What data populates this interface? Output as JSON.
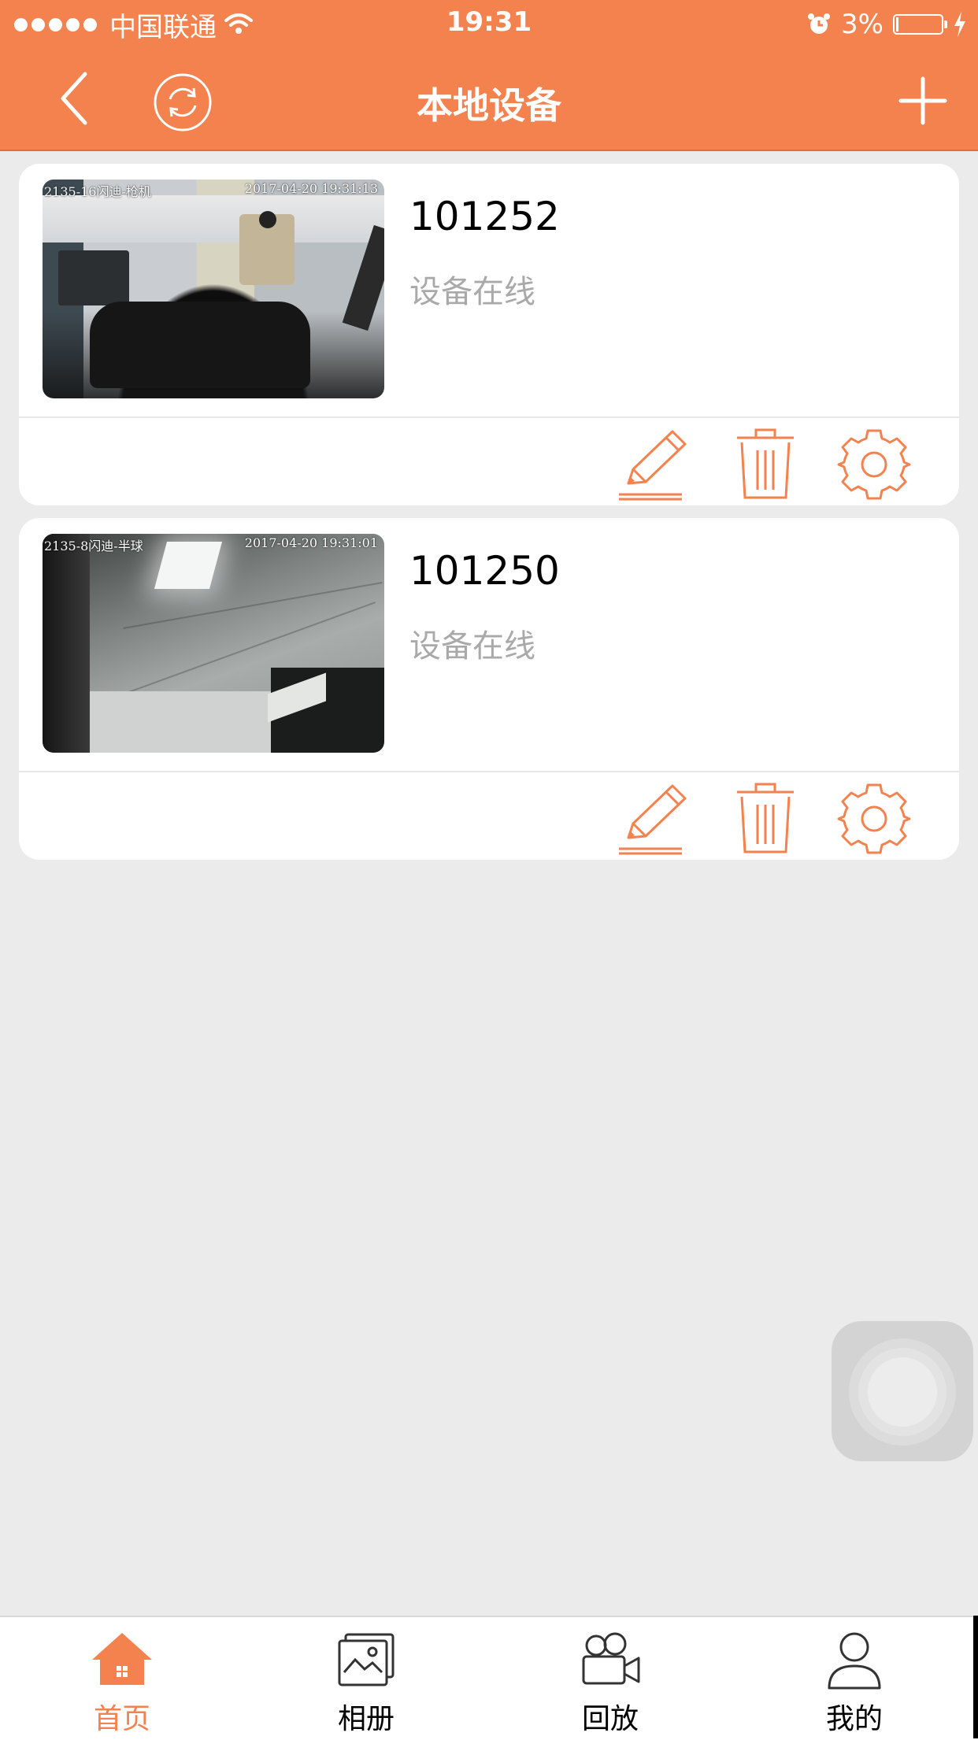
{
  "status_bar": {
    "carrier": "中国联通",
    "time": "19:31",
    "battery": "3%"
  },
  "nav": {
    "title": "本地设备"
  },
  "devices": [
    {
      "id": "101252",
      "status": "设备在线",
      "overlay_left": "2135-16闪迪-枪机",
      "overlay_right": "2017-04-20 19:31:13"
    },
    {
      "id": "101250",
      "status": "设备在线",
      "overlay_left": "2135-8闪迪-半球",
      "overlay_right": "2017-04-20 19:31:01"
    }
  ],
  "tabs": [
    {
      "label": "首页",
      "icon": "home-icon",
      "active": true
    },
    {
      "label": "相册",
      "icon": "album-icon",
      "active": false
    },
    {
      "label": "回放",
      "icon": "playback-camera-icon",
      "active": false
    },
    {
      "label": "我的",
      "icon": "profile-icon",
      "active": false
    }
  ],
  "colors": {
    "accent": "#f4824e",
    "background": "#ebebeb",
    "status_text": "#a9a9a9"
  }
}
